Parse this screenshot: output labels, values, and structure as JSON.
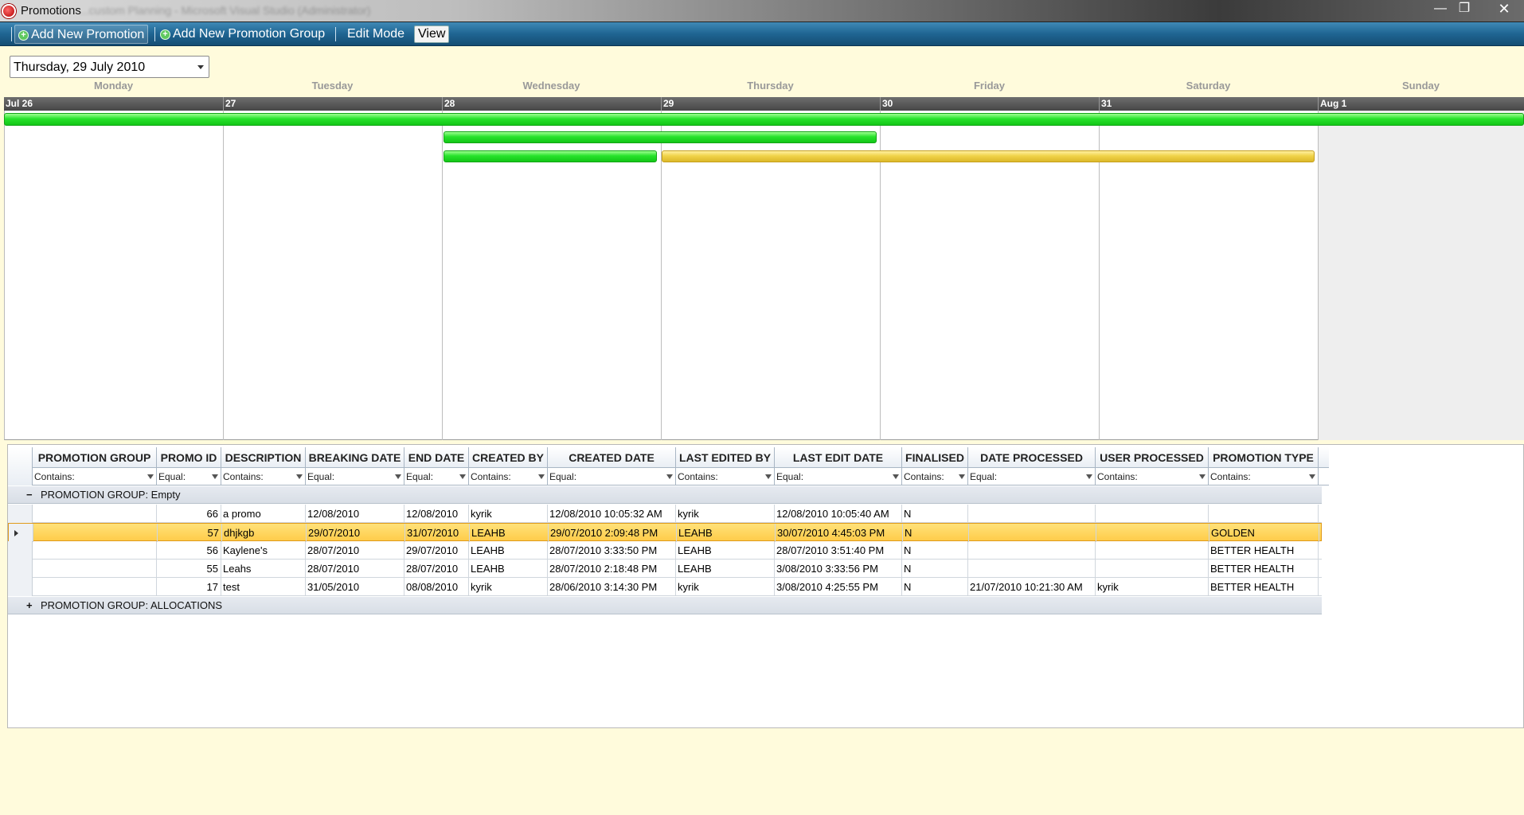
{
  "window": {
    "title": "Promotions",
    "ghost_title": "...custom Planning - Microsoft Visual Studio (Administrator)",
    "buttons": {
      "minimize": "—",
      "restore": "❐",
      "close": "✕"
    }
  },
  "toolbar": {
    "add_promotion": "Add New Promotion",
    "add_group": "Add New Promotion Group",
    "edit_mode": "Edit Mode",
    "view": "View"
  },
  "date_picker": {
    "value": "Thursday, 29 July 2010"
  },
  "calendar": {
    "day_names": [
      "Monday",
      "Tuesday",
      "Wednesday",
      "Thursday",
      "Friday",
      "Saturday",
      "Sunday"
    ],
    "dates": [
      "Jul 26",
      "27",
      "28",
      "29",
      "30",
      "31",
      "Aug 1"
    ]
  },
  "grid": {
    "columns": [
      {
        "header": "PROMOTION GROUP",
        "filter": "Contains:"
      },
      {
        "header": "PROMO ID",
        "filter": "Equal:"
      },
      {
        "header": "DESCRIPTION",
        "filter": "Contains:"
      },
      {
        "header": "BREAKING DATE",
        "filter": "Equal:"
      },
      {
        "header": "END DATE",
        "filter": "Equal:"
      },
      {
        "header": "CREATED BY",
        "filter": "Contains:"
      },
      {
        "header": "CREATED DATE",
        "filter": "Equal:"
      },
      {
        "header": "LAST EDITED BY",
        "filter": "Contains:"
      },
      {
        "header": "LAST EDIT DATE",
        "filter": "Equal:"
      },
      {
        "header": "FINALISED",
        "filter": "Contains:"
      },
      {
        "header": "DATE PROCESSED",
        "filter": "Equal:"
      },
      {
        "header": "USER PROCESSED",
        "filter": "Contains:"
      },
      {
        "header": "PROMOTION TYPE",
        "filter": "Contains:"
      }
    ],
    "groups": [
      {
        "toggle": "−",
        "label": "PROMOTION GROUP: Empty"
      },
      {
        "toggle": "+",
        "label": "PROMOTION GROUP: ALLOCATIONS"
      }
    ],
    "rows": [
      [
        "",
        "66",
        "a promo",
        "12/08/2010",
        "12/08/2010",
        "kyrik",
        "12/08/2010 10:05:32 AM",
        "kyrik",
        "12/08/2010 10:05:40 AM",
        "N",
        "",
        "",
        ""
      ],
      [
        "",
        "57",
        "dhjkgb",
        "29/07/2010",
        "31/07/2010",
        "LEAHB",
        "29/07/2010 2:09:48 PM",
        "LEAHB",
        "30/07/2010 4:45:03 PM",
        "N",
        "",
        "",
        "GOLDEN"
      ],
      [
        "",
        "56",
        "Kaylene's",
        "28/07/2010",
        "29/07/2010",
        "LEAHB",
        "28/07/2010 3:33:50 PM",
        "LEAHB",
        "28/07/2010 3:51:40 PM",
        "N",
        "",
        "",
        "BETTER HEALTH"
      ],
      [
        "",
        "55",
        "Leahs",
        "28/07/2010",
        "28/07/2010",
        "LEAHB",
        "28/07/2010 2:18:48 PM",
        "LEAHB",
        "3/08/2010 3:33:56 PM",
        "N",
        "",
        "",
        "BETTER HEALTH"
      ],
      [
        "",
        "17",
        "test",
        "31/05/2010",
        "08/08/2010",
        "kyrik",
        "28/06/2010 3:14:30 PM",
        "kyrik",
        "3/08/2010 4:25:55 PM",
        "N",
        "21/07/2010 10:21:30 AM",
        "kyrik",
        "BETTER HEALTH"
      ]
    ]
  },
  "colors": {
    "toolbar": "#1f6592",
    "background": "#fffbdc",
    "selected_row": "#ffcc4a",
    "bar_green": "#27e22b",
    "bar_yellow": "#f0d34a"
  }
}
